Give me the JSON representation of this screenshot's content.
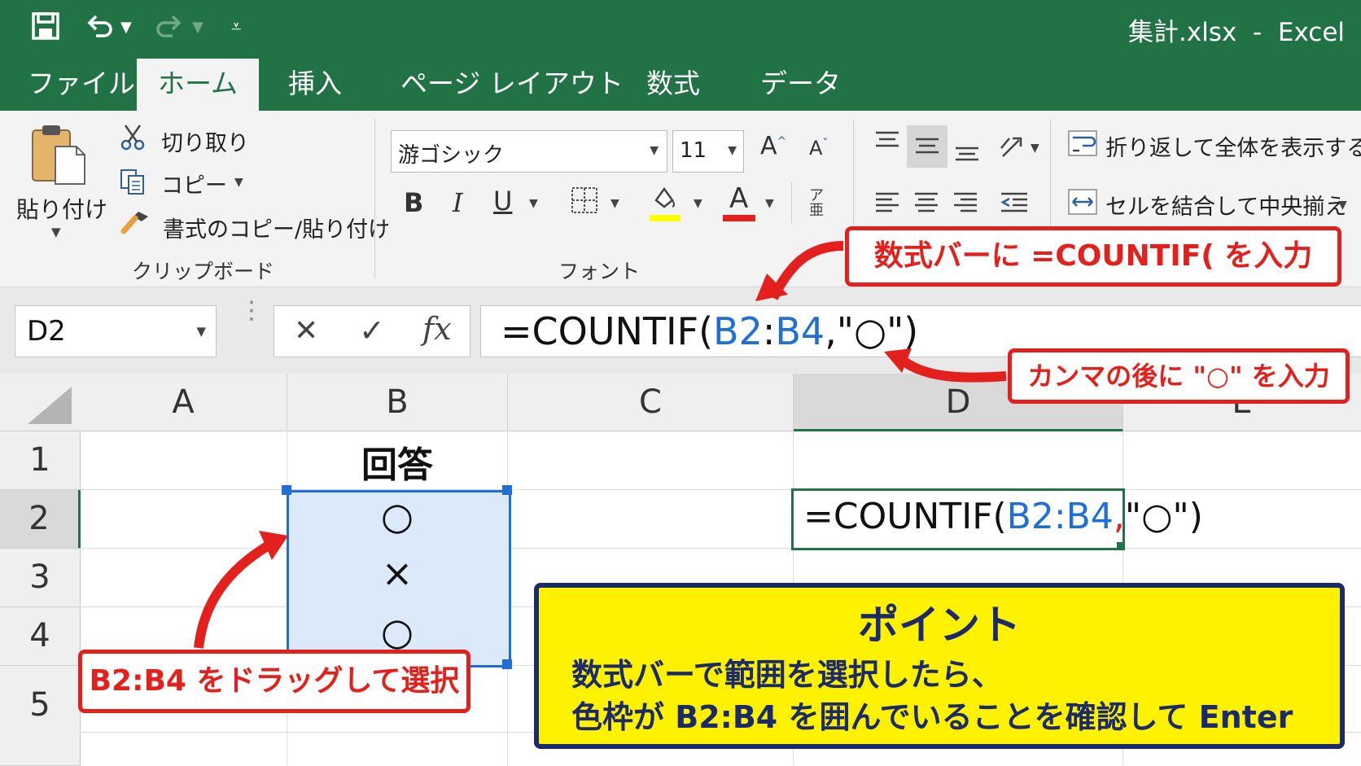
{
  "window": {
    "title": "集計.xlsx  -  Excel"
  },
  "tabs": [
    "ファイル",
    "ホーム",
    "挿入",
    "ページ レイアウト",
    "数式",
    "データ"
  ],
  "clipboard": {
    "paste_label": "貼り付け",
    "cut_label": "切り取り",
    "copy_label": "コピー",
    "format_painter_label": "書式のコピー/貼り付け",
    "group_label": "クリップボード"
  },
  "font": {
    "name": "游ゴシック",
    "size": "11",
    "bold": "B",
    "italic": "I",
    "underline": "U",
    "font_color_glyph": "A",
    "grow_glyph": "A",
    "shrink_glyph": "A",
    "group_label": "フォント",
    "highlight_color": "#ffff00",
    "font_color": "#e3201b"
  },
  "alignment": {
    "wrap_text_label": "折り返して全体を表示する",
    "merge_center_label": "セルを結合して中央揃え"
  },
  "formula_bar": {
    "name_box": "D2",
    "cancel": "✕",
    "enter": "✓",
    "fx": "fx",
    "formula_prefix": "=COUNTIF(",
    "range_start": "B2",
    "range_colon": ":",
    "range_end": "B4",
    "formula_suffix": ",\"○\")"
  },
  "grid": {
    "columns": [
      "A",
      "B",
      "C",
      "D",
      "E"
    ],
    "rows": [
      "1",
      "2",
      "3",
      "4",
      "5"
    ],
    "cells": {
      "B1": "回答",
      "B2": "○",
      "B3": "×",
      "B4": "○"
    },
    "d2_prefix": "=COUNTIF(",
    "d2_range": "B2:B4",
    "d2_comma": ",",
    "d2_suffix": "\"○\")"
  },
  "callouts": {
    "formula_bar": "数式バーに =COUNTIF( を入力",
    "comma": "カンマの後に \"○\" を入力",
    "drag": "B2:B4 をドラッグして選択"
  },
  "point": {
    "title": "ポイント",
    "line1": "数式バーで範囲を選択したら、",
    "line2": "色枠が B2:B4 を囲んでいることを確認して Enter"
  },
  "colors": {
    "excel_green": "#217346",
    "accent_red": "#e3201b",
    "range_blue": "#1f6fd6",
    "point_yellow": "#fff200",
    "point_navy": "#1b2a6b"
  }
}
